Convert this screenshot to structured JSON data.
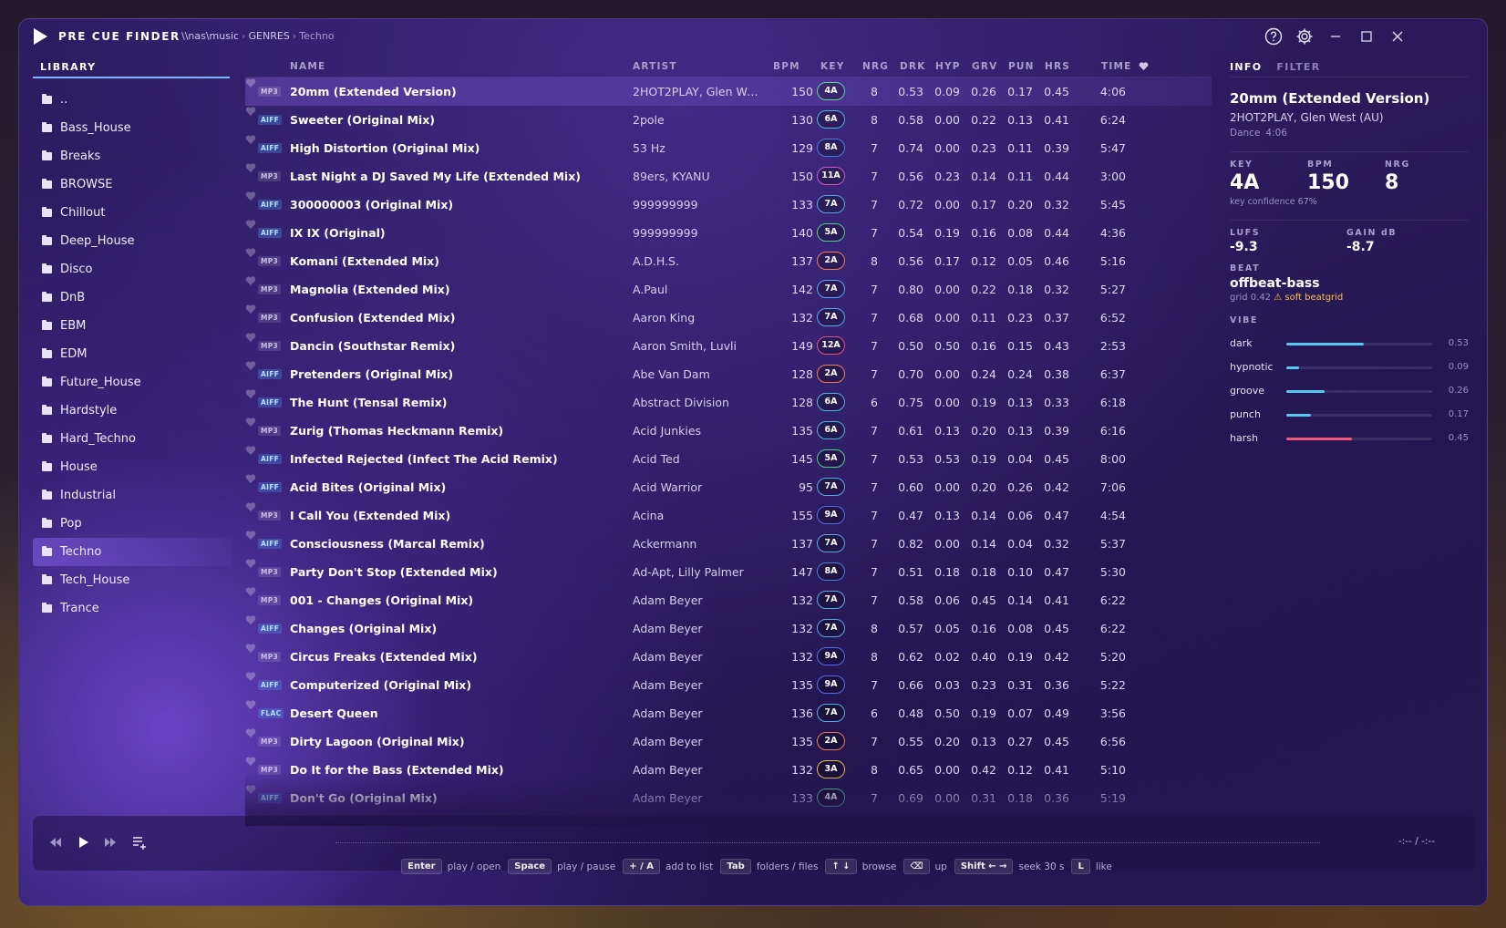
{
  "app": {
    "name": "PRE CUE FINDER"
  },
  "breadcrumb": [
    "\\\\nas\\music",
    "GENRES",
    "Techno"
  ],
  "library": {
    "tab": "LIBRARY",
    "items": [
      "..",
      "Bass_House",
      "Breaks",
      "BROWSE",
      "Chillout",
      "Deep_House",
      "Disco",
      "DnB",
      "EBM",
      "EDM",
      "Future_House",
      "Hardstyle",
      "Hard_Techno",
      "House",
      "Industrial",
      "Pop",
      "Techno",
      "Tech_House",
      "Trance"
    ],
    "active": "Techno"
  },
  "table": {
    "headers": {
      "name": "NAME",
      "artist": "ARTIST",
      "bpm": "BPM",
      "key": "KEY",
      "nrg": "NRG",
      "drk": "DRK",
      "hyp": "HYP",
      "grv": "GRV",
      "pun": "PUN",
      "hrs": "HRS",
      "time": "TIME"
    },
    "rows": [
      {
        "fmt": "MP3",
        "name": "20mm (Extended Version)",
        "artist": "2HOT2PLAY, Glen West ...",
        "bpm": "150",
        "key": "4A",
        "nrg": "8",
        "drk": "0.53",
        "hyp": "0.09",
        "grv": "0.26",
        "pun": "0.17",
        "hrs": "0.45",
        "time": "4:06",
        "key_color": "#5fd3a0"
      },
      {
        "fmt": "AIFF",
        "name": "Sweeter (Original Mix)",
        "artist": "2pole",
        "bpm": "130",
        "key": "6A",
        "nrg": "8",
        "drk": "0.58",
        "hyp": "0.00",
        "grv": "0.22",
        "pun": "0.13",
        "hrs": "0.41",
        "time": "6:24",
        "key_color": "#4ab8d8"
      },
      {
        "fmt": "AIFF",
        "name": "High Distortion (Original Mix)",
        "artist": "53 Hz",
        "bpm": "129",
        "key": "8A",
        "nrg": "7",
        "drk": "0.74",
        "hyp": "0.00",
        "grv": "0.23",
        "pun": "0.11",
        "hrs": "0.39",
        "time": "5:47",
        "key_color": "#4a7fe0"
      },
      {
        "fmt": "MP3",
        "name": "Last Night a DJ Saved My Life (Extended Mix)",
        "artist": "89ers, KYANU",
        "bpm": "150",
        "key": "11A",
        "nrg": "7",
        "drk": "0.56",
        "hyp": "0.23",
        "grv": "0.14",
        "pun": "0.11",
        "hrs": "0.44",
        "time": "3:00",
        "key_color": "#d455c8"
      },
      {
        "fmt": "AIFF",
        "name": "300000003 (Original Mix)",
        "artist": "999999999",
        "bpm": "133",
        "key": "7A",
        "nrg": "7",
        "drk": "0.72",
        "hyp": "0.00",
        "grv": "0.17",
        "pun": "0.20",
        "hrs": "0.32",
        "time": "5:45",
        "key_color": "#5aa8e8"
      },
      {
        "fmt": "AIFF",
        "name": "IX IX (Original)",
        "artist": "999999999",
        "bpm": "140",
        "key": "5A",
        "nrg": "7",
        "drk": "0.54",
        "hyp": "0.19",
        "grv": "0.16",
        "pun": "0.08",
        "hrs": "0.44",
        "time": "4:36",
        "key_color": "#4fcf8a"
      },
      {
        "fmt": "MP3",
        "name": "Komani (Extended Mix)",
        "artist": "A.D.H.S.",
        "bpm": "137",
        "key": "2A",
        "nrg": "8",
        "drk": "0.56",
        "hyp": "0.17",
        "grv": "0.12",
        "pun": "0.05",
        "hrs": "0.46",
        "time": "5:16",
        "key_color": "#f07a5a"
      },
      {
        "fmt": "MP3",
        "name": "Magnolia (Extended Mix)",
        "artist": "A.Paul",
        "bpm": "142",
        "key": "7A",
        "nrg": "7",
        "drk": "0.80",
        "hyp": "0.00",
        "grv": "0.22",
        "pun": "0.18",
        "hrs": "0.32",
        "time": "5:27",
        "key_color": "#5aa8e8"
      },
      {
        "fmt": "MP3",
        "name": "Confusion (Extended Mix)",
        "artist": "Aaron King",
        "bpm": "132",
        "key": "7A",
        "nrg": "7",
        "drk": "0.68",
        "hyp": "0.00",
        "grv": "0.11",
        "pun": "0.23",
        "hrs": "0.37",
        "time": "6:52",
        "key_color": "#5aa8e8"
      },
      {
        "fmt": "MP3",
        "name": "Dancin (Southstar Remix)",
        "artist": "Aaron Smith, Luvli",
        "bpm": "149",
        "key": "12A",
        "nrg": "7",
        "drk": "0.50",
        "hyp": "0.50",
        "grv": "0.16",
        "pun": "0.15",
        "hrs": "0.43",
        "time": "2:53",
        "key_color": "#e8508a"
      },
      {
        "fmt": "AIFF",
        "name": "Pretenders (Original Mix)",
        "artist": "Abe Van Dam",
        "bpm": "128",
        "key": "2A",
        "nrg": "7",
        "drk": "0.70",
        "hyp": "0.00",
        "grv": "0.24",
        "pun": "0.24",
        "hrs": "0.38",
        "time": "6:37",
        "key_color": "#f07a5a"
      },
      {
        "fmt": "AIFF",
        "name": "The Hunt (Tensal Remix)",
        "artist": "Abstract Division",
        "bpm": "128",
        "key": "6A",
        "nrg": "6",
        "drk": "0.75",
        "hyp": "0.00",
        "grv": "0.19",
        "pun": "0.13",
        "hrs": "0.33",
        "time": "6:18",
        "key_color": "#4ab8d8"
      },
      {
        "fmt": "MP3",
        "name": "Zurig (Thomas Heckmann Remix)",
        "artist": "Acid Junkies",
        "bpm": "135",
        "key": "6A",
        "nrg": "7",
        "drk": "0.61",
        "hyp": "0.13",
        "grv": "0.20",
        "pun": "0.13",
        "hrs": "0.39",
        "time": "6:16",
        "key_color": "#4ab8d8"
      },
      {
        "fmt": "AIFF",
        "name": "Infected Rejected (Infect The Acid Remix)",
        "artist": "Acid Ted",
        "bpm": "145",
        "key": "5A",
        "nrg": "7",
        "drk": "0.53",
        "hyp": "0.53",
        "grv": "0.19",
        "pun": "0.04",
        "hrs": "0.45",
        "time": "8:00",
        "key_color": "#4fcf8a"
      },
      {
        "fmt": "AIFF",
        "name": "Acid Bites (Original Mix)",
        "artist": "Acid Warrior",
        "bpm": "95",
        "key": "7A",
        "nrg": "7",
        "drk": "0.60",
        "hyp": "0.00",
        "grv": "0.20",
        "pun": "0.26",
        "hrs": "0.42",
        "time": "7:06",
        "key_color": "#5aa8e8"
      },
      {
        "fmt": "MP3",
        "name": "I Call You (Extended Mix)",
        "artist": "Acina",
        "bpm": "155",
        "key": "9A",
        "nrg": "7",
        "drk": "0.47",
        "hyp": "0.13",
        "grv": "0.14",
        "pun": "0.06",
        "hrs": "0.47",
        "time": "4:54",
        "key_color": "#5a6ae8"
      },
      {
        "fmt": "AIFF",
        "name": "Consciousness (Marcal Remix)",
        "artist": "Ackermann",
        "bpm": "137",
        "key": "7A",
        "nrg": "7",
        "drk": "0.82",
        "hyp": "0.00",
        "grv": "0.14",
        "pun": "0.04",
        "hrs": "0.32",
        "time": "5:37",
        "key_color": "#5aa8e8"
      },
      {
        "fmt": "MP3",
        "name": "Party Don't Stop (Extended Mix)",
        "artist": "Ad-Apt, Lilly Palmer",
        "bpm": "147",
        "key": "8A",
        "nrg": "7",
        "drk": "0.51",
        "hyp": "0.18",
        "grv": "0.18",
        "pun": "0.10",
        "hrs": "0.47",
        "time": "5:30",
        "key_color": "#4a7fe0"
      },
      {
        "fmt": "MP3",
        "name": "001 - Changes (Original Mix)",
        "artist": "Adam Beyer",
        "bpm": "132",
        "key": "7A",
        "nrg": "7",
        "drk": "0.58",
        "hyp": "0.06",
        "grv": "0.45",
        "pun": "0.14",
        "hrs": "0.41",
        "time": "6:22",
        "key_color": "#5aa8e8"
      },
      {
        "fmt": "AIFF",
        "name": "Changes (Original Mix)",
        "artist": "Adam Beyer",
        "bpm": "132",
        "key": "7A",
        "nrg": "8",
        "drk": "0.57",
        "hyp": "0.05",
        "grv": "0.16",
        "pun": "0.08",
        "hrs": "0.45",
        "time": "6:22",
        "key_color": "#5aa8e8"
      },
      {
        "fmt": "MP3",
        "name": "Circus Freaks (Extended Mix)",
        "artist": "Adam Beyer",
        "bpm": "132",
        "key": "9A",
        "nrg": "8",
        "drk": "0.62",
        "hyp": "0.02",
        "grv": "0.40",
        "pun": "0.19",
        "hrs": "0.42",
        "time": "5:20",
        "key_color": "#5a6ae8"
      },
      {
        "fmt": "AIFF",
        "name": "Computerized (Original Mix)",
        "artist": "Adam Beyer",
        "bpm": "135",
        "key": "9A",
        "nrg": "7",
        "drk": "0.66",
        "hyp": "0.03",
        "grv": "0.23",
        "pun": "0.31",
        "hrs": "0.36",
        "time": "5:22",
        "key_color": "#5a6ae8"
      },
      {
        "fmt": "FLAC",
        "name": "Desert Queen",
        "artist": "Adam Beyer",
        "bpm": "136",
        "key": "7A",
        "nrg": "6",
        "drk": "0.48",
        "hyp": "0.50",
        "grv": "0.19",
        "pun": "0.07",
        "hrs": "0.49",
        "time": "3:56",
        "key_color": "#5aa8e8"
      },
      {
        "fmt": "MP3",
        "name": "Dirty Lagoon (Original Mix)",
        "artist": "Adam Beyer",
        "bpm": "135",
        "key": "2A",
        "nrg": "7",
        "drk": "0.55",
        "hyp": "0.20",
        "grv": "0.13",
        "pun": "0.27",
        "hrs": "0.45",
        "time": "6:56",
        "key_color": "#f07a5a"
      },
      {
        "fmt": "MP3",
        "name": "Do It for the Bass (Extended Mix)",
        "artist": "Adam Beyer",
        "bpm": "132",
        "key": "3A",
        "nrg": "8",
        "drk": "0.65",
        "hyp": "0.00",
        "grv": "0.42",
        "pun": "0.12",
        "hrs": "0.41",
        "time": "5:10",
        "key_color": "#e8c050"
      },
      {
        "fmt": "AIFF",
        "name": "Don't Go (Original Mix)",
        "artist": "Adam Beyer",
        "bpm": "133",
        "key": "4A",
        "nrg": "7",
        "drk": "0.69",
        "hyp": "0.00",
        "grv": "0.31",
        "pun": "0.18",
        "hrs": "0.36",
        "time": "5:19",
        "key_color": "#5fd3a0"
      }
    ]
  },
  "info": {
    "tabs": [
      "INFO",
      "FILTER"
    ],
    "title": "20mm (Extended Version)",
    "artist": "2HOT2PLAY, Glen West (AU)",
    "genre": "Dance",
    "length": "4:06",
    "key_label": "KEY",
    "key": "4A",
    "bpm_label": "BPM",
    "bpm": "150",
    "nrg_label": "NRG",
    "nrg": "8",
    "key_confidence": "key confidence 67%",
    "lufs_label": "LUFS",
    "lufs": "-9.3",
    "gain_label": "GAIN dB",
    "gain": "-8.7",
    "beat_label": "BEAT",
    "beat": "offbeat-bass",
    "grid_label": "grid",
    "grid_value": "0.42",
    "grid_warning": "⚠ soft beatgrid",
    "vibe_label": "VIBE",
    "vibe": [
      {
        "name": "dark",
        "value": "0.53",
        "frac": 0.53,
        "color": "#58c8f0"
      },
      {
        "name": "hypnotic",
        "value": "0.09",
        "frac": 0.09,
        "color": "#58c8f0"
      },
      {
        "name": "groove",
        "value": "0.26",
        "frac": 0.26,
        "color": "#58c8f0"
      },
      {
        "name": "punch",
        "value": "0.17",
        "frac": 0.17,
        "color": "#58c8f0"
      },
      {
        "name": "harsh",
        "value": "0.45",
        "frac": 0.45,
        "color": "#f05a7a"
      }
    ]
  },
  "player": {
    "time": "-:-- / -:--"
  },
  "shortcuts": [
    {
      "key": "Enter",
      "label": "play / open"
    },
    {
      "key": "Space",
      "label": "play / pause"
    },
    {
      "key": "+ / A",
      "label": "add to list"
    },
    {
      "key": "Tab",
      "label": "folders / files"
    },
    {
      "key": "↑ ↓",
      "label": "browse"
    },
    {
      "key": "⌫",
      "label": "up"
    },
    {
      "key": "Shift ← →",
      "label": "seek 30 s"
    },
    {
      "key": "L",
      "label": "like"
    }
  ]
}
